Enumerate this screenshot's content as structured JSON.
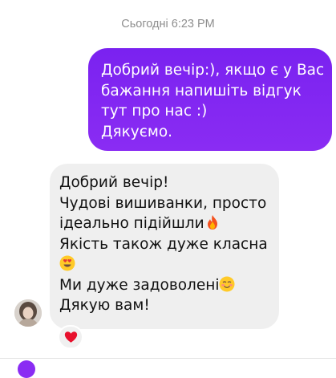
{
  "chat": {
    "timestamp": "Сьогодні 6:23 PM",
    "outgoing": {
      "lines": [
        "Добрий вечір:), якщо є у Вас",
        "бажання напишіть відгук",
        "тут про нас :)",
        "Дякуємо."
      ]
    },
    "incoming": {
      "lines": [
        "Добрий вечір!",
        "Чудові вишиванки, просто",
        "ідеально підійшли",
        "Якість також дуже класна",
        "Ми дуже задоволені",
        "Дякую вам!"
      ],
      "emojis": [
        "fire-emoji",
        "heart-eyes-emoji",
        "smiling-face-emoji"
      ]
    },
    "reaction": "red-heart-emoji"
  },
  "colors": {
    "outgoing_bubble": "#8a2cf3",
    "incoming_bubble": "#efefef",
    "timestamp": "#8e8e8e",
    "reaction_heart": "#e8112d"
  }
}
